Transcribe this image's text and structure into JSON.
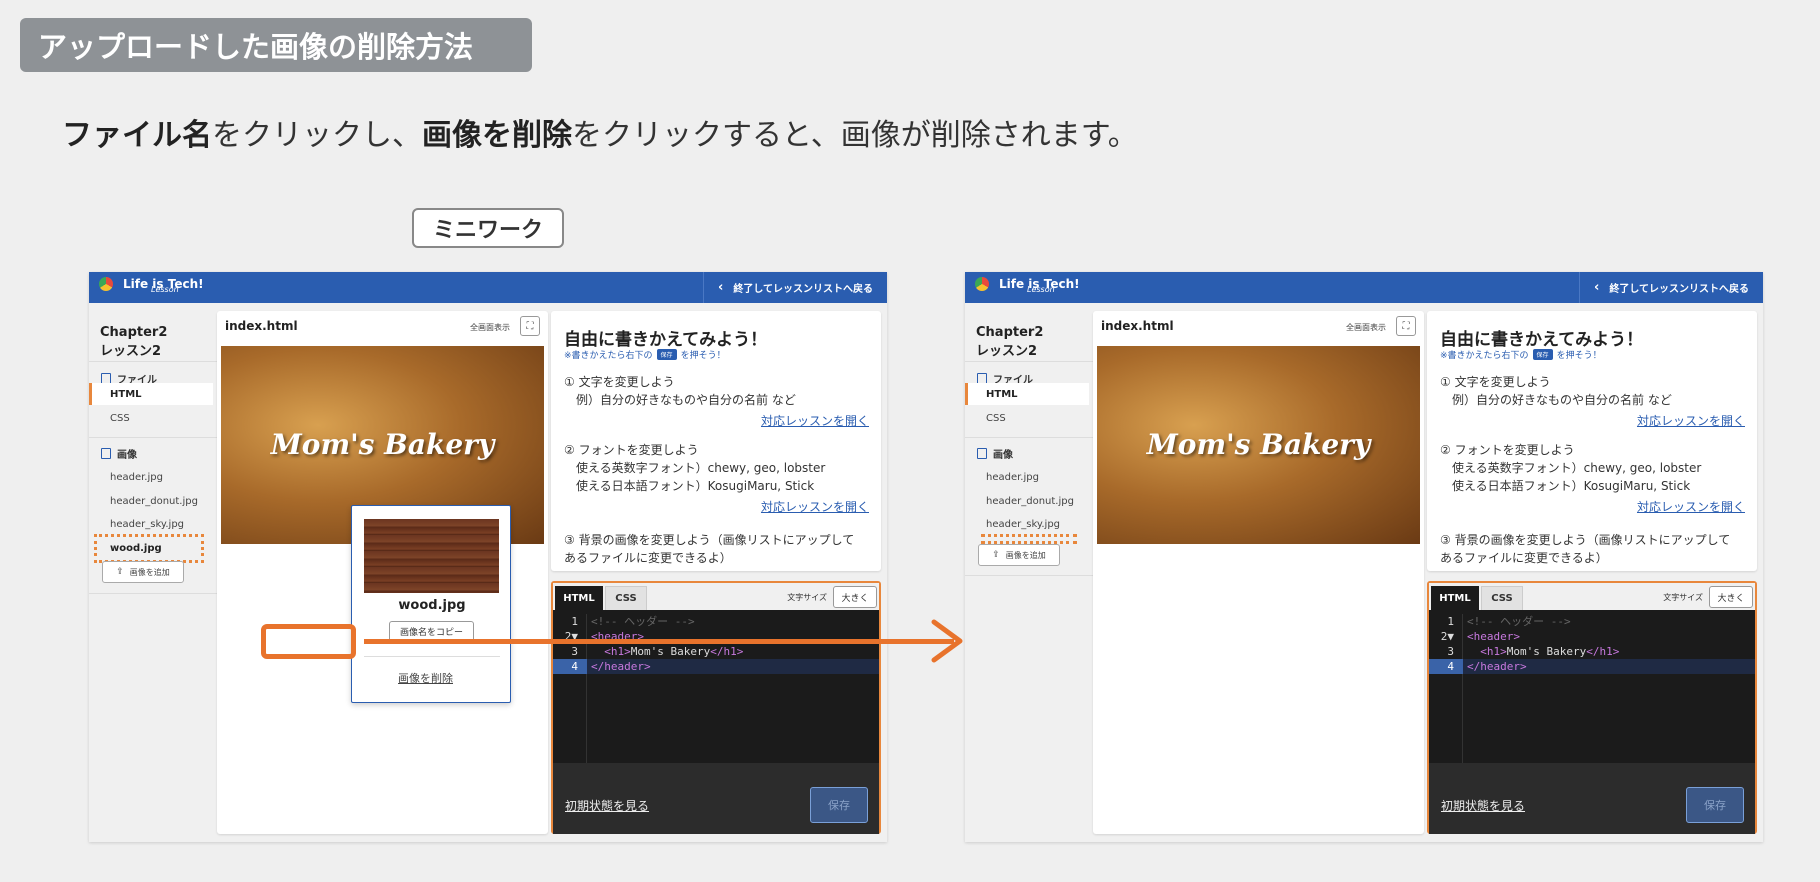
{
  "heading": "アップロードした画像の削除方法",
  "instruction": {
    "part1": "ファイル名",
    "part2": "をクリックし、",
    "part3": "画像を削除",
    "part4": "をクリックすると、画像が削除されます。"
  },
  "mini_work": "ミニワーク",
  "app": {
    "logo_text": "Life is Tech!",
    "logo_sub": "Lesson",
    "back_label": "終了してレッスンリストへ戻る",
    "chapter_line1": "Chapter2",
    "chapter_line2": "レッスン2",
    "files_label": "ファイル",
    "file_items": [
      "HTML",
      "CSS"
    ],
    "images_label": "画像",
    "image_items": [
      "header.jpg",
      "header_donut.jpg",
      "header_sky.jpg",
      "wood.jpg"
    ],
    "add_image_label": "画像を追加",
    "preview_filename": "index.html",
    "fullscreen_label": "全画面表示",
    "hero_text": "Mom's Bakery",
    "popup": {
      "filename": "wood.jpg",
      "copy_label": "画像名をコピー",
      "delete_label": "画像を削除"
    },
    "lesson": {
      "title": "自由に書きかえてみよう！",
      "sub_before": "※書きかえたら右下の",
      "sub_chip": "保存",
      "sub_after": "を押そう！",
      "item1": "① 文字を変更しよう",
      "item1_ex": "例）自分の好きなものや自分の名前 など",
      "link": "対応レッスンを開く",
      "item2": "② フォントを変更しよう",
      "item2_en": "使える英数字フォント）chewy, geo, lobster",
      "item2_ja": "使える日本語フォント）KosugiMaru, Stick",
      "item3_a": "③ 背景の画像を変更しよう（画像リストにアップして",
      "item3_b": "あるファイルに変更できるよ）"
    },
    "editor": {
      "tab_html": "HTML",
      "tab_css": "CSS",
      "font_size_label": "文字サイズ",
      "big_label": "大きく",
      "line_numbers": [
        "1",
        "2▼",
        "3",
        "4"
      ],
      "code_line1": "<!-- ヘッダー -->",
      "code_line2": "<header>",
      "code_line3_open": "<h1>",
      "code_line3_text": "Mom's Bakery",
      "code_line3_close": "</h1>",
      "code_line4": "</header>",
      "reset_label": "初期状態を見る",
      "save_label": "保存"
    }
  },
  "colors": {
    "accent_orange": "#e8732c",
    "brand_blue": "#2a5db0",
    "heading_bg": "#8e9296"
  }
}
